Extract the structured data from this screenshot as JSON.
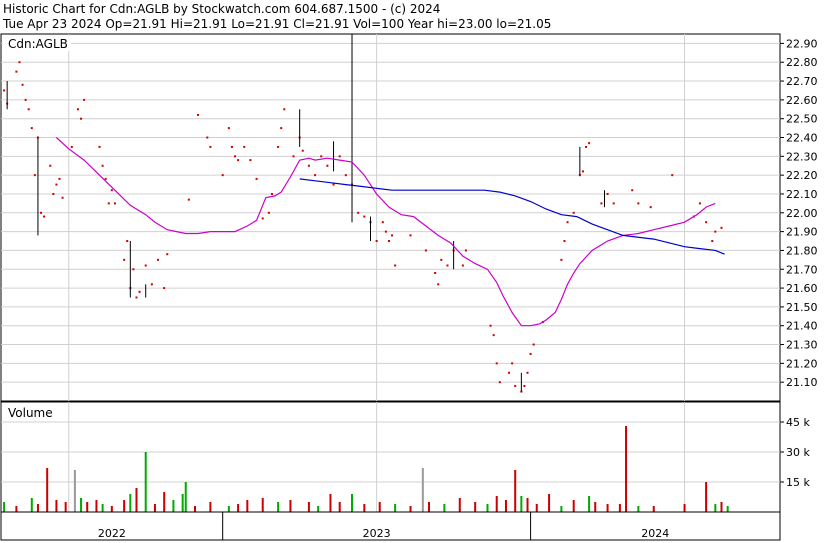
{
  "header": {
    "line1": "Historic Chart for Cdn:AGLB by Stockwatch.com 604.687.1500 - (c) 2024",
    "line2": "Tue Apr 23 2024  Op=21.91  Hi=21.91  Lo=21.91  Cl=21.91  Vol=100  Year hi=23.00  lo=21.05"
  },
  "colors": {
    "ma_short": "#cc00cc",
    "ma_long": "#0000cc",
    "price_tick": "#cc0000",
    "vol_up": "#00aa00",
    "vol_down": "#cc0000",
    "vol_flat": "#999999"
  },
  "chart_data": [
    {
      "type": "line",
      "title": "Cdn:AGLB",
      "ylim": [
        21.0,
        22.95
      ],
      "y_ticks": [
        "22.90",
        "22.80",
        "22.70",
        "22.60",
        "22.50",
        "22.40",
        "22.30",
        "22.20",
        "22.10",
        "22.00",
        "21.90",
        "21.80",
        "21.70",
        "21.60",
        "21.50",
        "21.40",
        "21.30",
        "21.20",
        "21.10"
      ],
      "x_labels": [
        "2022",
        "2023",
        "2024"
      ],
      "x_range": [
        2021.78,
        2024.31
      ],
      "x_label_positions": [
        2022.0,
        2023.0,
        2024.0
      ],
      "grid": true,
      "price_ticks": [
        [
          2021.79,
          22.65
        ],
        [
          2021.8,
          22.58
        ],
        [
          2021.83,
          22.75
        ],
        [
          2021.84,
          22.8
        ],
        [
          2021.85,
          22.68
        ],
        [
          2021.86,
          22.6
        ],
        [
          2021.87,
          22.55
        ],
        [
          2021.88,
          22.45
        ],
        [
          2021.89,
          22.2
        ],
        [
          2021.9,
          22.4
        ],
        [
          2021.91,
          22.0
        ],
        [
          2021.92,
          21.98
        ],
        [
          2021.94,
          22.25
        ],
        [
          2021.95,
          22.1
        ],
        [
          2021.96,
          22.15
        ],
        [
          2021.97,
          22.18
        ],
        [
          2021.98,
          22.08
        ],
        [
          2022.01,
          22.35
        ],
        [
          2022.03,
          22.55
        ],
        [
          2022.04,
          22.5
        ],
        [
          2022.05,
          22.6
        ],
        [
          2022.1,
          22.35
        ],
        [
          2022.11,
          22.25
        ],
        [
          2022.12,
          22.18
        ],
        [
          2022.13,
          22.05
        ],
        [
          2022.14,
          22.12
        ],
        [
          2022.15,
          22.05
        ],
        [
          2022.18,
          21.75
        ],
        [
          2022.19,
          21.85
        ],
        [
          2022.2,
          21.6
        ],
        [
          2022.21,
          21.7
        ],
        [
          2022.22,
          21.55
        ],
        [
          2022.23,
          21.58
        ],
        [
          2022.25,
          21.72
        ],
        [
          2022.27,
          21.62
        ],
        [
          2022.29,
          21.75
        ],
        [
          2022.32,
          21.78
        ],
        [
          2022.31,
          21.6
        ],
        [
          2022.39,
          22.07
        ],
        [
          2022.42,
          22.52
        ],
        [
          2022.45,
          22.4
        ],
        [
          2022.46,
          22.35
        ],
        [
          2022.5,
          22.2
        ],
        [
          2022.52,
          22.45
        ],
        [
          2022.53,
          22.35
        ],
        [
          2022.54,
          22.3
        ],
        [
          2022.55,
          22.28
        ],
        [
          2022.57,
          22.35
        ],
        [
          2022.59,
          22.28
        ],
        [
          2022.61,
          22.18
        ],
        [
          2022.63,
          21.97
        ],
        [
          2022.65,
          22.0
        ],
        [
          2022.66,
          22.1
        ],
        [
          2022.68,
          22.35
        ],
        [
          2022.69,
          22.45
        ],
        [
          2022.7,
          22.55
        ],
        [
          2022.73,
          22.3
        ],
        [
          2022.75,
          22.4
        ],
        [
          2022.76,
          22.33
        ],
        [
          2022.78,
          22.25
        ],
        [
          2022.8,
          22.2
        ],
        [
          2022.82,
          22.3
        ],
        [
          2022.84,
          22.25
        ],
        [
          2022.86,
          22.15
        ],
        [
          2022.88,
          22.3
        ],
        [
          2022.9,
          22.2
        ],
        [
          2022.92,
          22.15
        ],
        [
          2022.94,
          22.0
        ],
        [
          2022.96,
          21.98
        ],
        [
          2022.98,
          21.95
        ],
        [
          2023.0,
          21.85
        ],
        [
          2023.02,
          21.95
        ],
        [
          2023.03,
          21.9
        ],
        [
          2023.04,
          21.85
        ],
        [
          2023.05,
          21.88
        ],
        [
          2023.06,
          21.72
        ],
        [
          2023.11,
          21.88
        ],
        [
          2023.16,
          21.8
        ],
        [
          2023.19,
          21.68
        ],
        [
          2023.2,
          21.62
        ],
        [
          2023.21,
          21.75
        ],
        [
          2023.23,
          21.72
        ],
        [
          2023.25,
          21.8
        ],
        [
          2023.28,
          21.72
        ],
        [
          2023.29,
          21.8
        ],
        [
          2023.37,
          21.4
        ],
        [
          2023.38,
          21.35
        ],
        [
          2023.39,
          21.2
        ],
        [
          2023.4,
          21.1
        ],
        [
          2023.43,
          21.15
        ],
        [
          2023.44,
          21.2
        ],
        [
          2023.45,
          21.08
        ],
        [
          2023.47,
          21.05
        ],
        [
          2023.48,
          21.08
        ],
        [
          2023.49,
          21.15
        ],
        [
          2023.5,
          21.25
        ],
        [
          2023.51,
          21.3
        ],
        [
          2023.54,
          21.42
        ],
        [
          2023.6,
          21.75
        ],
        [
          2023.61,
          21.85
        ],
        [
          2023.62,
          21.95
        ],
        [
          2023.64,
          22.0
        ],
        [
          2023.66,
          22.2
        ],
        [
          2023.67,
          22.22
        ],
        [
          2023.68,
          22.35
        ],
        [
          2023.69,
          22.37
        ],
        [
          2023.73,
          22.05
        ],
        [
          2023.75,
          22.1
        ],
        [
          2023.77,
          22.05
        ],
        [
          2023.83,
          22.12
        ],
        [
          2023.85,
          22.05
        ],
        [
          2023.89,
          22.03
        ],
        [
          2023.96,
          22.2
        ],
        [
          2024.03,
          21.98
        ],
        [
          2024.05,
          22.05
        ],
        [
          2024.07,
          21.95
        ],
        [
          2024.09,
          21.85
        ],
        [
          2024.1,
          21.9
        ],
        [
          2024.12,
          21.92
        ]
      ],
      "range_bars": [
        [
          2021.8,
          22.55,
          22.7
        ],
        [
          2021.9,
          21.88,
          22.4
        ],
        [
          2022.2,
          21.55,
          21.85
        ],
        [
          2022.25,
          21.55,
          21.62
        ],
        [
          2022.75,
          22.35,
          22.55
        ],
        [
          2022.86,
          22.22,
          22.38
        ],
        [
          2022.92,
          21.95,
          22.95
        ],
        [
          2022.98,
          21.85,
          21.98
        ],
        [
          2023.25,
          21.7,
          21.85
        ],
        [
          2023.47,
          21.05,
          21.15
        ],
        [
          2023.66,
          22.2,
          22.35
        ],
        [
          2023.74,
          22.03,
          22.12
        ]
      ],
      "series": [
        {
          "x": [
            2021.96,
            2022.0,
            2022.05,
            2022.1,
            2022.15,
            2022.2,
            2022.25,
            2022.28,
            2022.32,
            2022.35,
            2022.38,
            2022.42,
            2022.46,
            2022.5,
            2022.54,
            2022.58,
            2022.61,
            2022.64,
            2022.67,
            2022.69,
            2022.72,
            2022.75,
            2022.78,
            2022.8,
            2022.84,
            2022.88,
            2022.92,
            2022.96,
            2023.0,
            2023.04,
            2023.08,
            2023.12,
            2023.16,
            2023.2,
            2023.24,
            2023.28,
            2023.32,
            2023.36,
            2023.39,
            2023.41,
            2023.44,
            2023.47,
            2023.5,
            2023.53,
            2023.55,
            2023.58,
            2023.6,
            2023.62,
            2023.64,
            2023.66,
            2023.7,
            2023.75,
            2023.8,
            2023.85,
            2023.9,
            2023.95,
            2024.0,
            2024.04,
            2024.07,
            2024.1
          ],
          "y": [
            22.4,
            22.34,
            22.28,
            22.2,
            22.12,
            22.04,
            21.99,
            21.95,
            21.91,
            21.9,
            21.89,
            21.89,
            21.9,
            21.9,
            21.9,
            21.93,
            21.96,
            22.08,
            22.09,
            22.11,
            22.19,
            22.28,
            22.29,
            22.28,
            22.29,
            22.28,
            22.27,
            22.2,
            22.1,
            22.03,
            21.99,
            21.98,
            21.93,
            21.88,
            21.84,
            21.77,
            21.73,
            21.7,
            21.63,
            21.56,
            21.47,
            21.4,
            21.4,
            21.41,
            21.43,
            21.47,
            21.54,
            21.62,
            21.68,
            21.73,
            21.8,
            21.85,
            21.88,
            21.89,
            21.91,
            21.93,
            21.95,
            21.99,
            22.03,
            22.05
          ]
        },
        {
          "x": [
            2022.75,
            2022.8,
            2022.85,
            2022.9,
            2022.95,
            2023.0,
            2023.05,
            2023.1,
            2023.2,
            2023.3,
            2023.35,
            2023.4,
            2023.45,
            2023.5,
            2023.55,
            2023.6,
            2023.65,
            2023.7,
            2023.8,
            2023.9,
            2024.0,
            2024.05,
            2024.1,
            2024.13
          ],
          "y": [
            22.18,
            22.17,
            22.16,
            22.15,
            22.14,
            22.13,
            22.12,
            22.12,
            22.12,
            22.12,
            22.12,
            22.11,
            22.09,
            22.06,
            22.02,
            21.99,
            21.98,
            21.94,
            21.88,
            21.86,
            21.82,
            21.81,
            21.8,
            21.78
          ]
        }
      ]
    },
    {
      "type": "bar",
      "title": "Volume",
      "ylim": [
        0,
        55000
      ],
      "y_ticks": [
        "45 k",
        "30 k",
        "15 k"
      ],
      "bars": [
        [
          2021.79,
          5000,
          "u"
        ],
        [
          2021.83,
          3000,
          "d"
        ],
        [
          2021.88,
          7000,
          "u"
        ],
        [
          2021.9,
          4000,
          "d"
        ],
        [
          2021.93,
          22000,
          "d"
        ],
        [
          2021.96,
          6000,
          "d"
        ],
        [
          2021.99,
          5000,
          "d"
        ],
        [
          2022.02,
          21000,
          "f"
        ],
        [
          2022.04,
          7000,
          "u"
        ],
        [
          2022.06,
          5000,
          "d"
        ],
        [
          2022.09,
          6000,
          "d"
        ],
        [
          2022.11,
          4000,
          "u"
        ],
        [
          2022.14,
          3000,
          "d"
        ],
        [
          2022.18,
          6000,
          "d"
        ],
        [
          2022.2,
          9000,
          "u"
        ],
        [
          2022.22,
          12000,
          "d"
        ],
        [
          2022.25,
          30000,
          "u"
        ],
        [
          2022.28,
          4000,
          "d"
        ],
        [
          2022.31,
          10000,
          "d"
        ],
        [
          2022.34,
          6000,
          "u"
        ],
        [
          2022.37,
          9000,
          "u"
        ],
        [
          2022.38,
          15000,
          "u"
        ],
        [
          2022.41,
          3000,
          "d"
        ],
        [
          2022.46,
          5000,
          "d"
        ],
        [
          2022.52,
          3000,
          "u"
        ],
        [
          2022.55,
          4000,
          "d"
        ],
        [
          2022.58,
          6000,
          "d"
        ],
        [
          2022.63,
          7000,
          "d"
        ],
        [
          2022.68,
          5000,
          "u"
        ],
        [
          2022.72,
          6000,
          "d"
        ],
        [
          2022.78,
          5000,
          "d"
        ],
        [
          2022.81,
          3000,
          "u"
        ],
        [
          2022.85,
          9000,
          "d"
        ],
        [
          2022.88,
          5000,
          "d"
        ],
        [
          2022.92,
          9000,
          "u"
        ],
        [
          2022.96,
          4000,
          "d"
        ],
        [
          2023.01,
          5000,
          "d"
        ],
        [
          2023.06,
          4000,
          "u"
        ],
        [
          2023.11,
          3000,
          "d"
        ],
        [
          2023.15,
          22000,
          "f"
        ],
        [
          2023.17,
          5000,
          "d"
        ],
        [
          2023.22,
          4000,
          "u"
        ],
        [
          2023.27,
          7000,
          "d"
        ],
        [
          2023.32,
          5000,
          "d"
        ],
        [
          2023.36,
          4000,
          "u"
        ],
        [
          2023.39,
          8000,
          "d"
        ],
        [
          2023.42,
          6000,
          "d"
        ],
        [
          2023.45,
          21000,
          "d"
        ],
        [
          2023.47,
          8000,
          "u"
        ],
        [
          2023.49,
          7000,
          "d"
        ],
        [
          2023.52,
          4000,
          "d"
        ],
        [
          2023.56,
          9000,
          "d"
        ],
        [
          2023.6,
          3000,
          "u"
        ],
        [
          2023.64,
          6000,
          "d"
        ],
        [
          2023.69,
          8000,
          "u"
        ],
        [
          2023.71,
          5000,
          "d"
        ],
        [
          2023.75,
          4000,
          "d"
        ],
        [
          2023.79,
          4000,
          "d"
        ],
        [
          2023.81,
          43000,
          "d"
        ],
        [
          2023.85,
          3000,
          "u"
        ],
        [
          2023.9,
          3000,
          "d"
        ],
        [
          2024.0,
          4000,
          "d"
        ],
        [
          2024.07,
          15000,
          "d"
        ],
        [
          2024.1,
          4000,
          "u"
        ],
        [
          2024.12,
          5000,
          "d"
        ],
        [
          2024.14,
          3000,
          "u"
        ]
      ]
    }
  ]
}
